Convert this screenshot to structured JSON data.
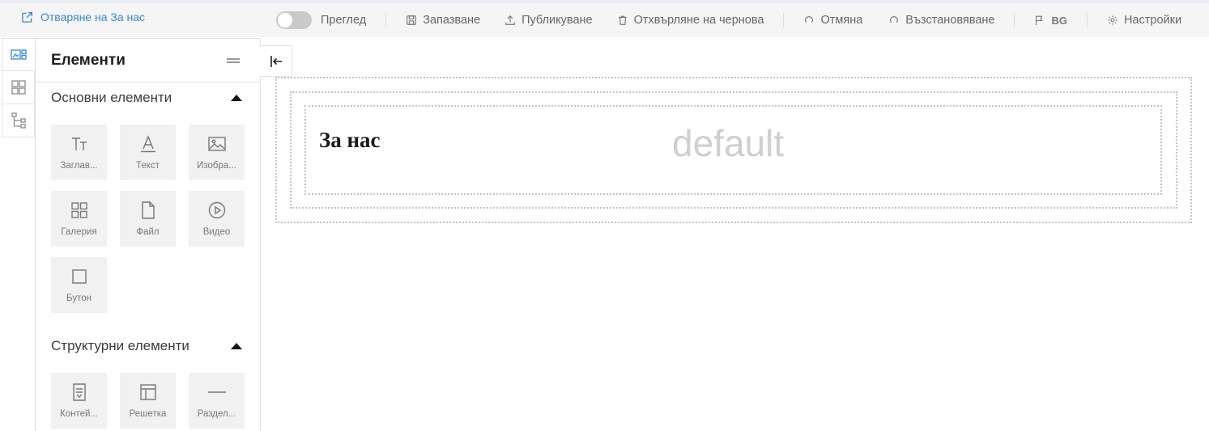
{
  "header": {
    "open_page_label": "Отваряне на За нас"
  },
  "toolbar": {
    "preview_label": "Преглед",
    "save_label": "Запазване",
    "publish_label": "Публикуване",
    "discard_label": "Отхвърляне на чернова",
    "undo_label": "Отмяна",
    "redo_label": "Възстановяване",
    "language_label": "BG",
    "settings_label": "Настройки"
  },
  "panel": {
    "title": "Елементи",
    "basic_section": {
      "title": "Основни елементи",
      "items": [
        {
          "label": "Заглав...",
          "icon": "heading-icon"
        },
        {
          "label": "Текст",
          "icon": "text-icon"
        },
        {
          "label": "Изобра...",
          "icon": "image-icon"
        },
        {
          "label": "Галерия",
          "icon": "gallery-icon"
        },
        {
          "label": "Файл",
          "icon": "file-icon"
        },
        {
          "label": "Видео",
          "icon": "video-icon"
        },
        {
          "label": "Бутон",
          "icon": "button-icon"
        }
      ]
    },
    "structural_section": {
      "title": "Структурни елементи",
      "items": [
        {
          "label": "Контей...",
          "icon": "container-icon"
        },
        {
          "label": "Решетка",
          "icon": "grid-layout-icon"
        },
        {
          "label": "Раздел...",
          "icon": "divider-icon"
        }
      ]
    }
  },
  "canvas": {
    "heading": "За нас",
    "placeholder": "default"
  },
  "colors": {
    "accent": "#3a86d1",
    "toolbar_bg": "#f5f5f5",
    "tile_bg": "#f1f1f1"
  }
}
